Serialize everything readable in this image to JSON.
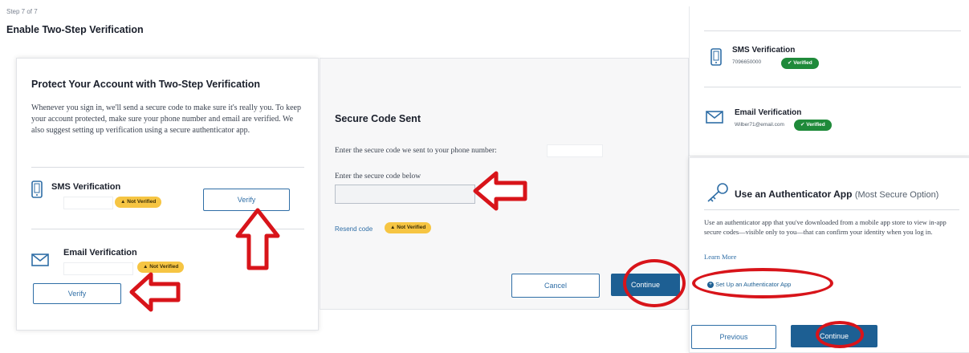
{
  "header": {
    "step": "Step 7 of 7",
    "title": "Enable Two-Step Verification"
  },
  "panel1": {
    "heading": "Protect Your Account with Two-Step Verification",
    "description": "Whenever you sign in, we'll send a secure code to make sure it's really you. To keep your account protected, make sure your phone number and email are verified. We also suggest setting up verification using a secure authenticator app.",
    "sms": {
      "label": "SMS Verification",
      "badge": "Not Verified",
      "verify_label": "Verify"
    },
    "email": {
      "label": "Email Verification",
      "badge": "Not Verified",
      "verify_label": "Verify"
    }
  },
  "panel2": {
    "heading": "Secure Code Sent",
    "sent_text": "Enter the secure code we sent to your phone number:",
    "input_label": "Enter the secure code below",
    "resend_label": "Resend code",
    "badge": "Not Verified",
    "cancel_label": "Cancel",
    "continue_label": "Continue"
  },
  "panel3": {
    "sms": {
      "label": "SMS Verification",
      "value": "7096650000",
      "badge": "Verified"
    },
    "email": {
      "label": "Email Verification",
      "value": "Wilber71@email.com",
      "badge": "Verified"
    },
    "auth": {
      "title": "Use an Authenticator App",
      "title_note": "(Most Secure Option)",
      "description": "Use an authenticator app that you've downloaded from a mobile app store to view in-app secure codes—visible only to you—that can confirm your identity when you log in.",
      "learn_more": "Learn More",
      "setup_label": "Set Up an Authenticator App"
    },
    "previous_label": "Previous",
    "continue_label": "Continue"
  },
  "colors": {
    "primary": "#1d5f93",
    "badge_warning": "#f6c543",
    "badge_success": "#1f8a3a",
    "annotation_red": "#d8141a"
  }
}
